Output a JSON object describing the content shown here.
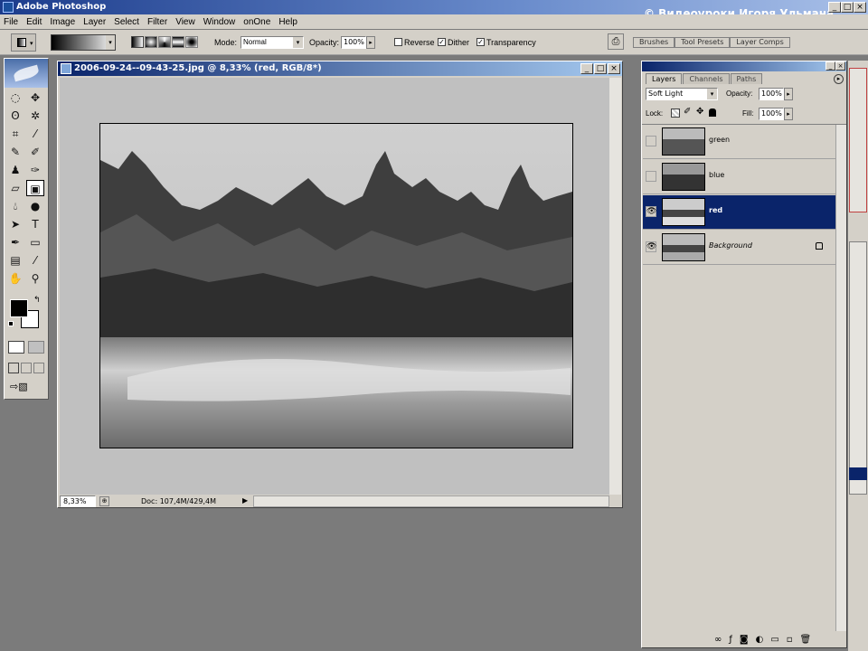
{
  "app": {
    "title": "Adobe Photoshop",
    "watermark": "© Видеоуроки Игоря Ульмана"
  },
  "window_controls": {
    "minimize": "_",
    "maximize": "□",
    "close": "×"
  },
  "menu": [
    "File",
    "Edit",
    "Image",
    "Layer",
    "Select",
    "Filter",
    "View",
    "Window",
    "onOne",
    "Help"
  ],
  "options_bar": {
    "mode_label": "Mode:",
    "mode_value": "Normal",
    "opacity_label": "Opacity:",
    "opacity_value": "100%",
    "reverse_label": "Reverse",
    "reverse_checked": false,
    "dither_label": "Dither",
    "dither_checked": true,
    "transparency_label": "Transparency",
    "transparency_checked": true,
    "palette_tabs": [
      "Brushes",
      "Tool Presets",
      "Layer Comps"
    ]
  },
  "document": {
    "title": "2006-09-24--09-43-25.jpg @ 8,33% (red, RGB/8*)",
    "zoom": "8,33%",
    "doc_info": "Doc: 107,4M/429,4M"
  },
  "layers_panel": {
    "tabs": [
      "Layers",
      "Channels",
      "Paths"
    ],
    "active_tab": "Layers",
    "blend_mode": "Soft Light",
    "opacity_label": "Opacity:",
    "opacity_value": "100%",
    "lock_label": "Lock:",
    "fill_label": "Fill:",
    "fill_value": "100%",
    "layers": [
      {
        "name": "green",
        "visible": false,
        "selected": false
      },
      {
        "name": "blue",
        "visible": false,
        "selected": false
      },
      {
        "name": "red",
        "visible": true,
        "selected": true
      },
      {
        "name": "Background",
        "visible": true,
        "selected": false,
        "locked": true
      }
    ]
  },
  "colors": {
    "titlebar": "#1c3c8c",
    "selection": "#0a246a",
    "chrome": "#d4d0c8",
    "workspace": "#7b7b7b"
  }
}
